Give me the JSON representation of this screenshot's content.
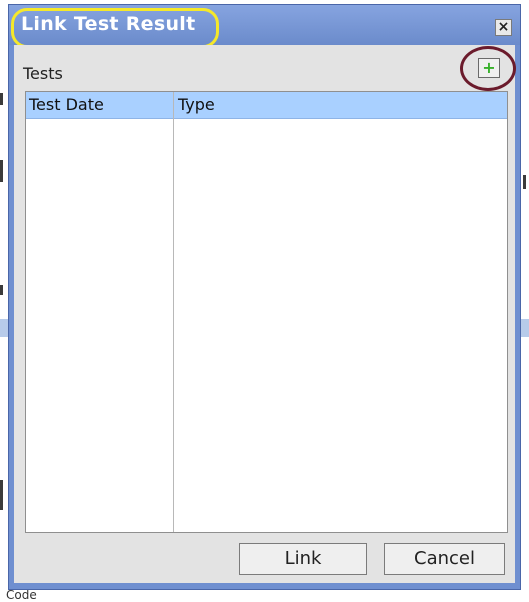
{
  "dialog": {
    "title": "Link Test Result",
    "close_glyph": "×",
    "tests_label": "Tests",
    "add_glyph": "+",
    "columns": [
      "Test Date",
      "Type"
    ],
    "link_label": "Link",
    "cancel_label": "Cancel"
  },
  "background": {
    "partial_text": "Code"
  },
  "colors": {
    "title_bar": "#6f8fd0",
    "header_row": "#a9d0ff",
    "add_icon": "#37b02a",
    "title_highlight": "#f5e82a",
    "add_highlight": "#6b1b2c"
  }
}
